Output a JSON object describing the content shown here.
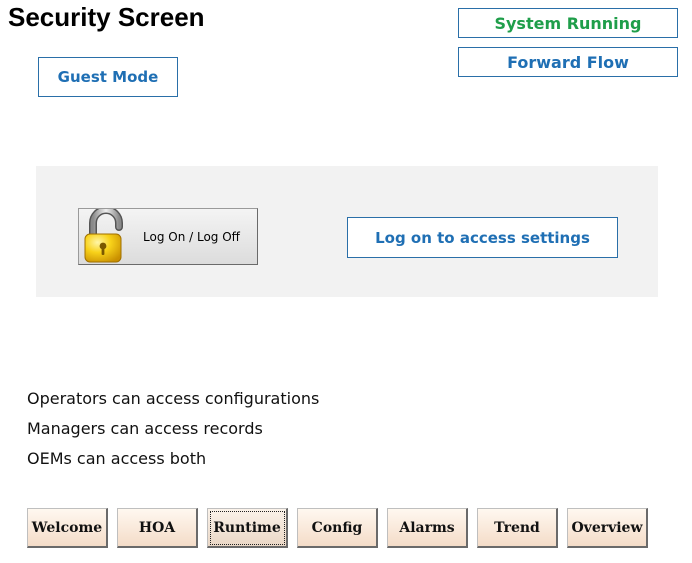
{
  "page": {
    "title": "Security Screen"
  },
  "status": {
    "system": "System Running",
    "flow": "Forward Flow",
    "mode": "Guest Mode"
  },
  "panel": {
    "logon_label": "Log On / Log Off",
    "access_message": "Log on to access settings"
  },
  "info": [
    "Operators can access configurations",
    "Managers can access records",
    "OEMs can access both"
  ],
  "nav": [
    {
      "label": "Welcome"
    },
    {
      "label": "HOA"
    },
    {
      "label": "Runtime",
      "active": true
    },
    {
      "label": "Config"
    },
    {
      "label": "Alarms"
    },
    {
      "label": "Trend"
    },
    {
      "label": "Overview"
    }
  ],
  "colors": {
    "running": "#1f9e4a",
    "accent": "#1f6fb4",
    "panel_bg": "#f2f2f2",
    "nav_bg": "#f4dcc8",
    "lock": "#f2c200"
  }
}
